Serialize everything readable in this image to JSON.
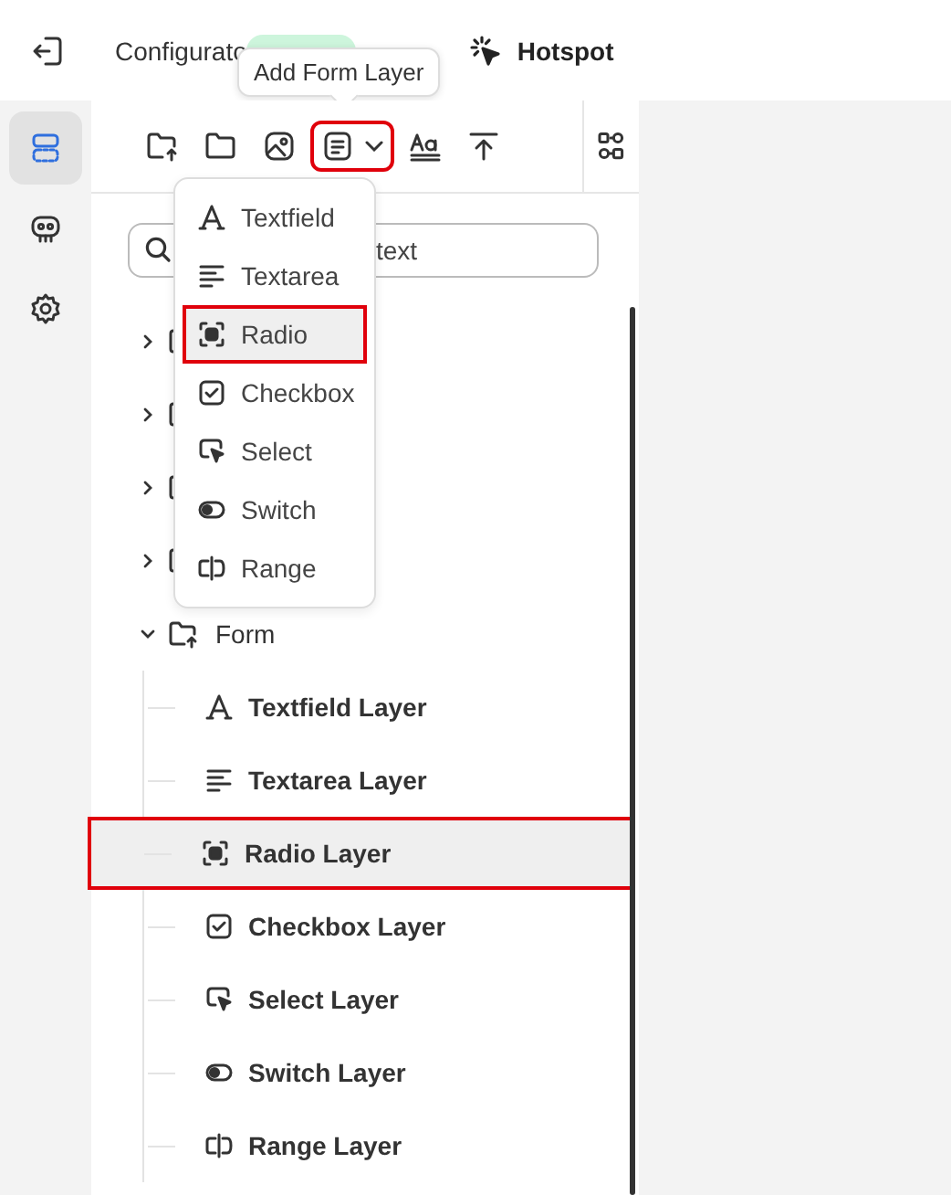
{
  "topbar": {
    "title": "Configurato",
    "hotspot_label": "Hotspot"
  },
  "tooltip": "Add Form Layer",
  "rail": [
    {
      "kind": "layers",
      "selected": true
    },
    {
      "kind": "robot",
      "selected": false
    },
    {
      "kind": "settings",
      "selected": false
    }
  ],
  "toolbar": [
    {
      "kind": "folder-add",
      "highlighted": false
    },
    {
      "kind": "folder",
      "highlighted": false
    },
    {
      "kind": "image",
      "highlighted": false
    },
    {
      "kind": "form",
      "highlighted": true
    },
    {
      "kind": "text-style",
      "highlighted": false
    },
    {
      "kind": "upload",
      "highlighted": false
    }
  ],
  "search": {
    "placeholder": "text"
  },
  "menu": [
    {
      "label": "Textfield",
      "kind": "textfield",
      "selected": false
    },
    {
      "label": "Textarea",
      "kind": "textarea",
      "selected": false
    },
    {
      "label": "Radio",
      "kind": "radio",
      "selected": true
    },
    {
      "label": "Checkbox",
      "kind": "checkbox",
      "selected": false
    },
    {
      "label": "Select",
      "kind": "select",
      "selected": false
    },
    {
      "label": "Switch",
      "kind": "switch",
      "selected": false
    },
    {
      "label": "Range",
      "kind": "range",
      "selected": false
    }
  ],
  "tree": [
    {
      "expanded": false
    },
    {
      "expanded": false
    },
    {
      "expanded": false
    },
    {
      "expanded": false
    },
    {
      "label": "Form",
      "expanded": true,
      "children": [
        {
          "label": "Textfield Layer",
          "kind": "textfield",
          "selected": false
        },
        {
          "label": "Textarea Layer",
          "kind": "textarea",
          "selected": false
        },
        {
          "label": "Radio Layer",
          "kind": "radio",
          "selected": true
        },
        {
          "label": "Checkbox Layer",
          "kind": "checkbox",
          "selected": false
        },
        {
          "label": "Select Layer",
          "kind": "select",
          "selected": false
        },
        {
          "label": "Switch Layer",
          "kind": "switch",
          "selected": false
        },
        {
          "label": "Range Layer",
          "kind": "range",
          "selected": false
        }
      ]
    }
  ]
}
